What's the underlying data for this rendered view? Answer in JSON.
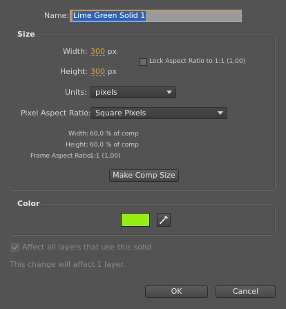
{
  "name": {
    "label": "Name:",
    "value": "Lime Green Solid 1"
  },
  "size": {
    "title": "Size",
    "width_label": "Width:",
    "width_value": "300",
    "width_unit": "px",
    "height_label": "Height:",
    "height_value": "300",
    "height_unit": "px",
    "lock_label": "Lock Aspect Ratio to 1:1 (1,00)",
    "units_label": "Units:",
    "units_value": "pixels",
    "par_label": "Pixel Aspect Ratio:",
    "par_value": "Square Pixels",
    "info_width_label": "Width:",
    "info_width_value": "60,0 % of comp",
    "info_height_label": "Height:",
    "info_height_value": "60,0 % of comp",
    "info_far_label": "Frame Aspect Ratio:",
    "info_far_value": "1:1 (1,00)",
    "make_comp_size": "Make Comp Size"
  },
  "color": {
    "title": "Color",
    "swatch_color": "#99ee11",
    "eyedropper_icon": "eyedropper-icon"
  },
  "affect_all_label": "Affect all layers that use this solid",
  "change_note": "This change will affect 1 layer.",
  "ok_label": "OK",
  "cancel_label": "Cancel"
}
